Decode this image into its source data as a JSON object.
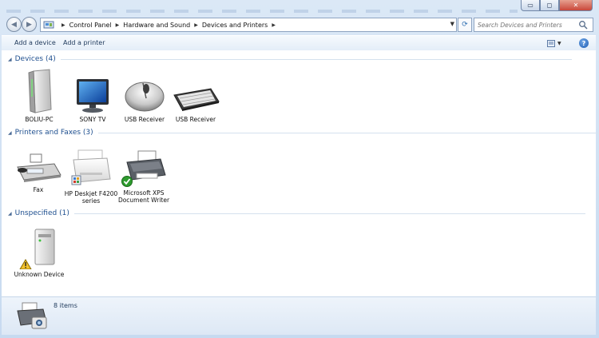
{
  "window": {
    "minimize_glyph": "▭",
    "maximize_glyph": "◻",
    "close_glyph": "✕"
  },
  "nav": {
    "back_glyph": "◀",
    "forward_glyph": "▶",
    "breadcrumbs": [
      "Control Panel",
      "Hardware and Sound",
      "Devices and Printers"
    ],
    "refresh_glyph": "⟳",
    "search_placeholder": "Search Devices and Printers"
  },
  "commandbar": {
    "add_device": "Add a device",
    "add_printer": "Add a printer",
    "help_glyph": "?"
  },
  "groups": {
    "devices": {
      "title": "Devices (4)",
      "items": [
        "BOLIU-PC",
        "SONY TV",
        "USB Receiver",
        "USB Receiver"
      ]
    },
    "printers": {
      "title": "Printers and Faxes (3)",
      "items": [
        {
          "line1": "Fax",
          "line2": ""
        },
        {
          "line1": "HP Deskjet F4200",
          "line2": "series"
        },
        {
          "line1": "Microsoft XPS",
          "line2": "Document Writer"
        }
      ]
    },
    "unspecified": {
      "title": "Unspecified (1)",
      "items": [
        "Unknown Device"
      ]
    }
  },
  "details": {
    "count": "8 items"
  },
  "icons": {
    "collapse_chevron": "chevron-down-icon",
    "default_printer_badge": "checkmark-icon",
    "warning_badge": "warning-icon"
  },
  "colors": {
    "group_title": "#1e4f8f",
    "frame": "#c7daf0",
    "check_green": "#2e9b2e",
    "warning_yellow": "#f2c12e"
  }
}
